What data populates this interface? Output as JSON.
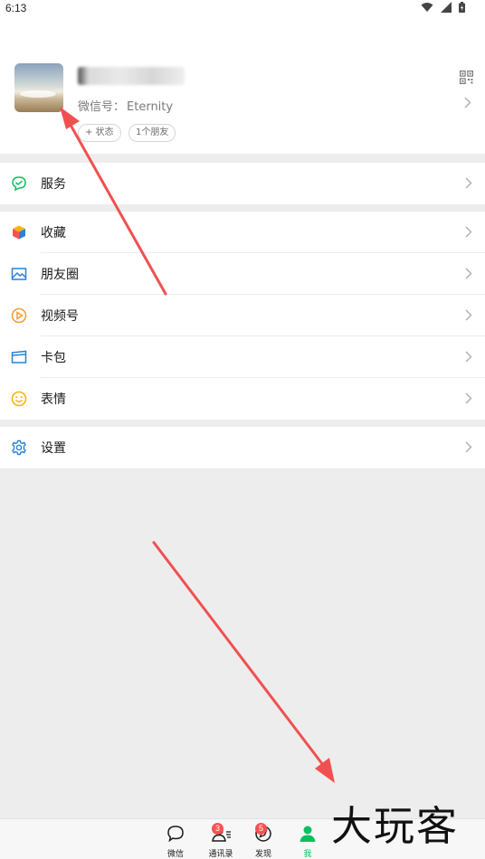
{
  "status_bar": {
    "time": "6:13",
    "icons": [
      "wifi-icon",
      "signal-icon",
      "battery-icon"
    ]
  },
  "profile": {
    "wechat_id_label": "微信号：",
    "wechat_id_value": "Eternity",
    "status_tag": "+ 状态",
    "friends_tag": "1个朋友"
  },
  "menu": {
    "services": {
      "label": "服务",
      "icon": "services-icon"
    },
    "favorites": {
      "label": "收藏",
      "icon": "favorites-cube-icon"
    },
    "moments": {
      "label": "朋友圈",
      "icon": "moments-image-icon"
    },
    "channels": {
      "label": "视频号",
      "icon": "channels-play-icon"
    },
    "cards": {
      "label": "卡包",
      "icon": "card-wallet-icon"
    },
    "stickers": {
      "label": "表情",
      "icon": "sticker-smile-icon"
    },
    "settings": {
      "label": "设置",
      "icon": "settings-gear-icon"
    }
  },
  "tabbar": {
    "chats": {
      "label": "微信"
    },
    "contacts": {
      "label": "通讯录",
      "badge": "3"
    },
    "discover": {
      "label": "发现",
      "badge": "5"
    },
    "me": {
      "label": "我",
      "active": true
    }
  },
  "watermark": "大玩客",
  "colors": {
    "accent_green": "#07c160",
    "badge_red": "#fa5151",
    "annotation_arrow": "#f05050",
    "background": "#ededed"
  }
}
